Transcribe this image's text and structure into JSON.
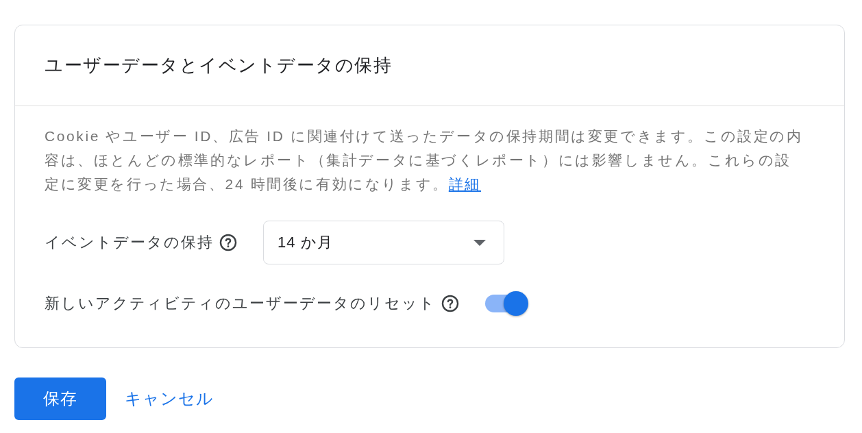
{
  "card": {
    "title": "ユーザーデータとイベントデータの保持",
    "description": {
      "text": "Cookie やユーザー ID、広告 ID に関連付けて送ったデータの保持期間は変更できます。この設定の内容は、ほとんどの標準的なレポート（集計データに基づくレポート）には影響しません。これらの設定に変更を行った場合、24 時間後に有効になります。",
      "link": "詳細"
    },
    "settings": [
      {
        "kind": "select",
        "label": "イベントデータの保持",
        "value": "14 か月"
      },
      {
        "kind": "toggle",
        "label": "新しいアクティビティのユーザーデータのリセット",
        "on": true
      }
    ]
  },
  "buttons": [
    {
      "kind": "primary",
      "label": "保存"
    },
    {
      "kind": "text",
      "label": "キャンセル"
    }
  ]
}
